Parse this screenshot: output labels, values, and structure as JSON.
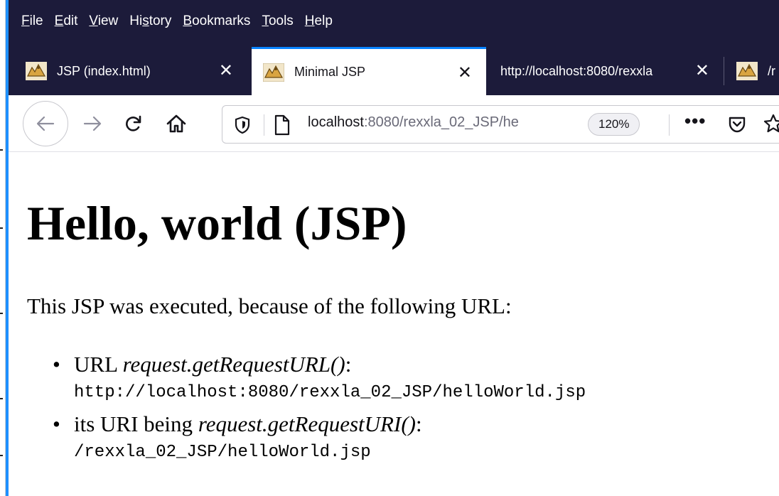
{
  "menubar": {
    "items": [
      {
        "label": "File",
        "accel": "F",
        "rest": "ile"
      },
      {
        "label": "Edit",
        "accel": "E",
        "rest": "dit"
      },
      {
        "label": "View",
        "accel": "V",
        "rest": "iew"
      },
      {
        "label": "History",
        "pre": "Hi",
        "accel": "s",
        "rest": "tory"
      },
      {
        "label": "Bookmarks",
        "accel": "B",
        "rest": "ookmarks"
      },
      {
        "label": "Tools",
        "accel": "T",
        "rest": "ools"
      },
      {
        "label": "Help",
        "accel": "H",
        "rest": "elp"
      }
    ]
  },
  "tabs": [
    {
      "title": "JSP (index.html)",
      "close": "✕",
      "active": false,
      "icon": "tomcat-favicon"
    },
    {
      "title": "Minimal JSP",
      "close": "✕",
      "active": true,
      "icon": "tomcat-favicon"
    },
    {
      "title": "http://localhost:8080/rexxla",
      "close": "✕",
      "active": false,
      "icon": "none"
    },
    {
      "title": "/r",
      "active": false,
      "icon": "tomcat-favicon"
    }
  ],
  "navbar": {
    "url_host": "localhost",
    "url_rest": ":8080/rexxla_02_JSP/he",
    "zoom": "120%",
    "more": "•••"
  },
  "page": {
    "heading": "Hello, world (JSP)",
    "intro": "This JSP was executed, because of the following URL:",
    "items": [
      {
        "bullet": "•",
        "label": "URL ",
        "call": "request.getRequestURL()",
        "suffix": ":",
        "value": "http://localhost:8080/rexxla_02_JSP/helloWorld.jsp"
      },
      {
        "bullet": "•",
        "label": "its URI being ",
        "call": "request.getRequestURI()",
        "suffix": ":",
        "value": "/rexxla_02_JSP/helloWorld.jsp"
      }
    ]
  },
  "colors": {
    "chrome_dark": "#1c1b3a",
    "tab_accent": "#0a84ff",
    "window_accent": "#1e90ff"
  }
}
